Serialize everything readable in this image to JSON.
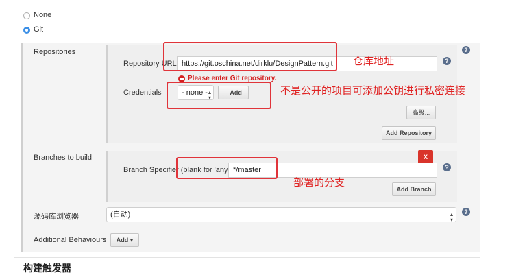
{
  "scm": {
    "options": [
      {
        "label": "None",
        "checked": false
      },
      {
        "label": "Git",
        "checked": true
      }
    ]
  },
  "repositories": {
    "label": "Repositories",
    "url_label": "Repository URL",
    "url_value": "https://git.oschina.net/dirklu/DesignPattern.git",
    "error": "Please enter Git repository.",
    "credentials_label": "Credentials",
    "credentials_value": "- none -",
    "add_button": "Add",
    "advanced_button": "高级...",
    "add_repository_button": "Add Repository"
  },
  "branches": {
    "label": "Branches to build",
    "delete_button": "X",
    "specifier_label": "Branch Specifier (blank for 'any')",
    "specifier_value": "*/master",
    "add_branch_button": "Add Branch"
  },
  "browser": {
    "label": "源码库浏览器",
    "value": "(自动)"
  },
  "behaviours": {
    "label": "Additional Behaviours",
    "add_button": "Add"
  },
  "build_trigger": {
    "title": "构建触发器"
  },
  "annotations": {
    "repo_note": "仓库地址",
    "cred_note": "不是公开的项目可添加公钥进行私密连接",
    "branch_note": "部署的分支"
  },
  "colors": {
    "annotation_red": "#e0343a",
    "radio_blue": "#3b8fe6",
    "help_icon": "#5a6e8c"
  }
}
